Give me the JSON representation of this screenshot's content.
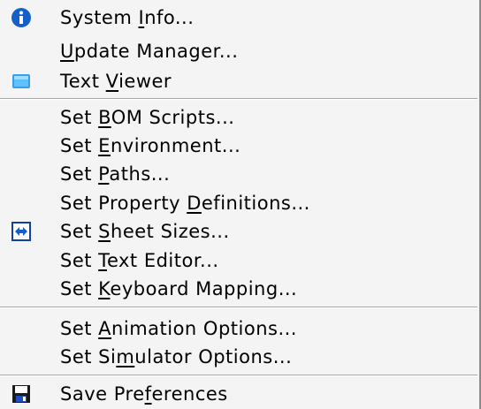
{
  "menu": {
    "items": [
      {
        "pre": "System ",
        "acc": "I",
        "post": "nfo...",
        "icon": "info-icon"
      },
      {
        "pre": "",
        "acc": "U",
        "post": "pdate Manager..."
      },
      {
        "pre": "Text ",
        "acc": "V",
        "post": "iewer",
        "icon": "text-viewer-icon"
      },
      {
        "pre": "Set ",
        "acc": "B",
        "post": "OM Scripts..."
      },
      {
        "pre": "Set ",
        "acc": "E",
        "post": "nvironment..."
      },
      {
        "pre": "Set ",
        "acc": "P",
        "post": "aths..."
      },
      {
        "pre": "Set Property ",
        "acc": "D",
        "post": "efinitions..."
      },
      {
        "pre": "Set ",
        "acc": "S",
        "post": "heet Sizes...",
        "icon": "sheet-sizes-icon"
      },
      {
        "pre": "Set ",
        "acc": "T",
        "post": "ext Editor..."
      },
      {
        "pre": "Set ",
        "acc": "K",
        "post": "eyboard Mapping..."
      },
      {
        "pre": "Set ",
        "acc": "A",
        "post": "nimation Options..."
      },
      {
        "pre": "Set Si",
        "acc": "m",
        "post": "ulator Options..."
      },
      {
        "pre": "Save Pre",
        "acc": "f",
        "post": "erences",
        "icon": "save-icon"
      }
    ]
  },
  "colors": {
    "menu_bg": "#f4f4f4",
    "info_blue": "#1560c8",
    "viewer_blue": "#3a9ee8"
  }
}
